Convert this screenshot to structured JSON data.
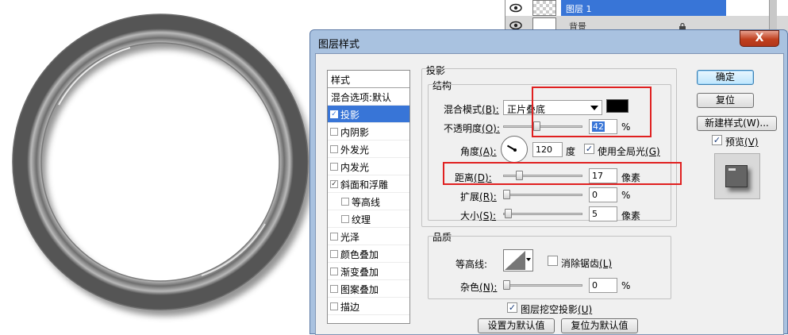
{
  "layers": {
    "selected_layer_name": "图层 1",
    "background_layer_name": "背景"
  },
  "dialog": {
    "title": "图层样式",
    "close_label": "X"
  },
  "style_list": {
    "header": "样式",
    "blend_defaults": "混合选项:默认",
    "items": [
      {
        "label": "投影",
        "checked": true,
        "active": true
      },
      {
        "label": "内阴影",
        "checked": false
      },
      {
        "label": "外发光",
        "checked": false
      },
      {
        "label": "内发光",
        "checked": false
      },
      {
        "label": "斜面和浮雕",
        "checked": true
      },
      {
        "label": "等高线",
        "checked": false,
        "indent": true
      },
      {
        "label": "纹理",
        "checked": false,
        "indent": true
      },
      {
        "label": "光泽",
        "checked": false
      },
      {
        "label": "颜色叠加",
        "checked": false
      },
      {
        "label": "渐变叠加",
        "checked": false
      },
      {
        "label": "图案叠加",
        "checked": false
      },
      {
        "label": "描边",
        "checked": false
      }
    ]
  },
  "shadow": {
    "section_title": "投影",
    "structure_title": "结构",
    "blend_mode_label": "混合模式",
    "blend_mode_key": "(B):",
    "blend_mode_value": "正片叠底",
    "shadow_color": "#000000",
    "opacity_label": "不透明度",
    "opacity_key": "(O):",
    "opacity_value": "42",
    "percent": "%",
    "angle_label": "角度",
    "angle_key": "(A):",
    "angle_value": "120",
    "degree": "度",
    "global_light_label": "使用全局光",
    "global_light_key": "(G)",
    "global_light_checked": true,
    "distance_label": "距离",
    "distance_key": "(D):",
    "distance_value": "17",
    "pixels": "像素",
    "spread_label": "扩展",
    "spread_key": "(R):",
    "spread_value": "0",
    "size_label": "大小",
    "size_key": "(S):",
    "size_value": "5"
  },
  "quality": {
    "title": "品质",
    "contour_label": "等高线:",
    "antialias_label": "消除锯齿",
    "antialias_key": "(L)",
    "antialias_checked": false,
    "noise_label": "杂色",
    "noise_key": "(N):",
    "noise_value": "0",
    "percent": "%",
    "knockout_label": "图层挖空投影",
    "knockout_key": "(U)",
    "knockout_checked": true,
    "set_default_label": "设置为默认值",
    "reset_default_label": "复位为默认值"
  },
  "actions": {
    "ok_label": "确定",
    "reset_label": "复位",
    "new_style_label": "新建样式(W)...",
    "preview_label": "预览",
    "preview_key": "(V)",
    "preview_checked": true
  },
  "colors": {
    "selection_blue": "#3875d7",
    "highlight_red": "#e02020",
    "title_bar": "#a9c2e0"
  }
}
